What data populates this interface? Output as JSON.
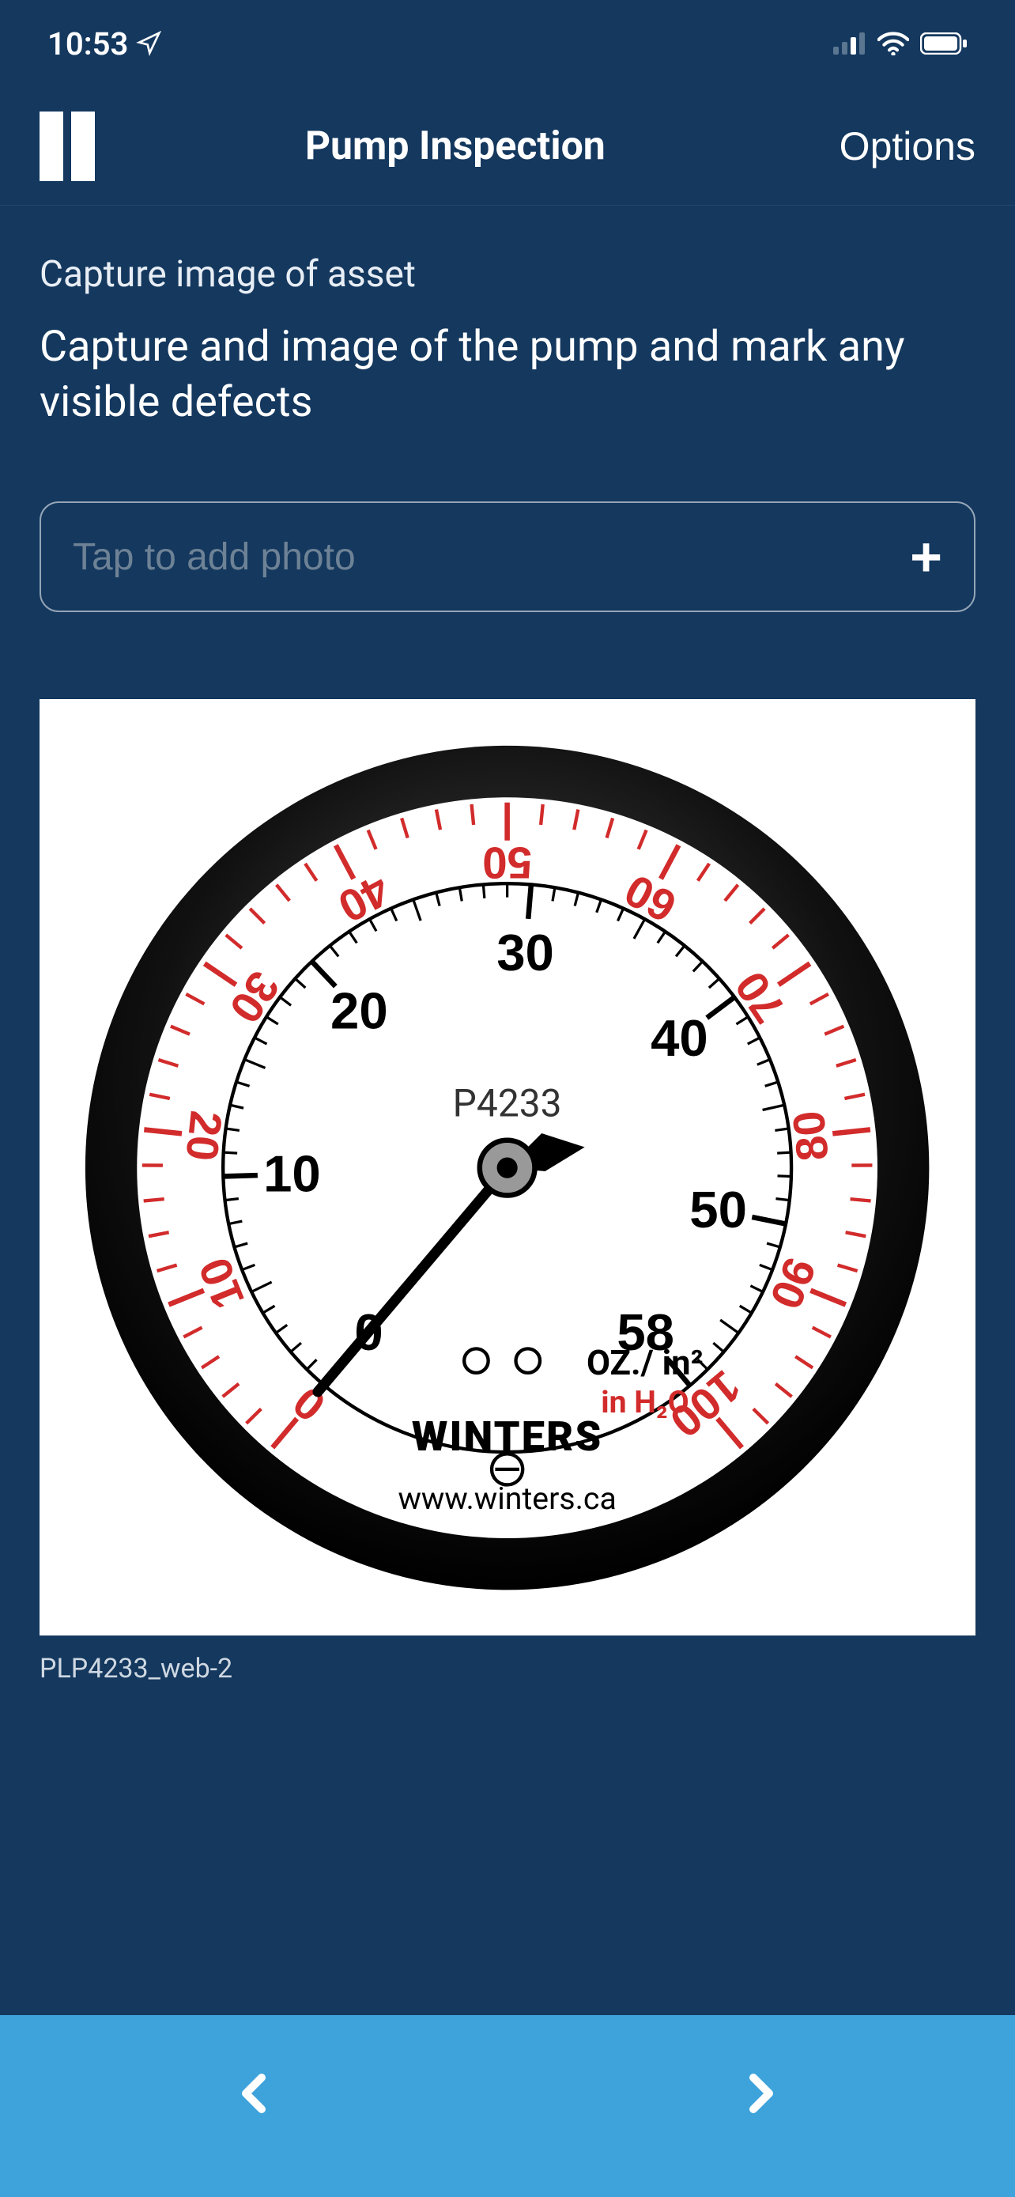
{
  "status_bar": {
    "time": "10:53"
  },
  "header": {
    "title": "Pump Inspection",
    "options_label": "Options"
  },
  "section": {
    "label": "Capture image of asset",
    "description": "Capture and image of the pump and mark any visible defects"
  },
  "add_photo": {
    "placeholder": "Tap to add photo"
  },
  "image": {
    "caption": "PLP4233_web-2"
  },
  "gauge": {
    "model": "P4233",
    "brand": "WINTERS",
    "website": "www.winters.ca",
    "inner_unit": "OZ./ in²",
    "outer_unit": "in H₂O",
    "inner_scale": {
      "min": 0,
      "max": 58,
      "labeled_ticks": [
        0,
        10,
        20,
        30,
        40,
        50,
        58
      ]
    },
    "outer_scale": {
      "min": 0,
      "max": 100,
      "labeled_ticks": [
        0,
        10,
        20,
        30,
        40,
        50,
        60,
        70,
        80,
        90,
        100
      ]
    },
    "needle_value_inner": 0
  }
}
